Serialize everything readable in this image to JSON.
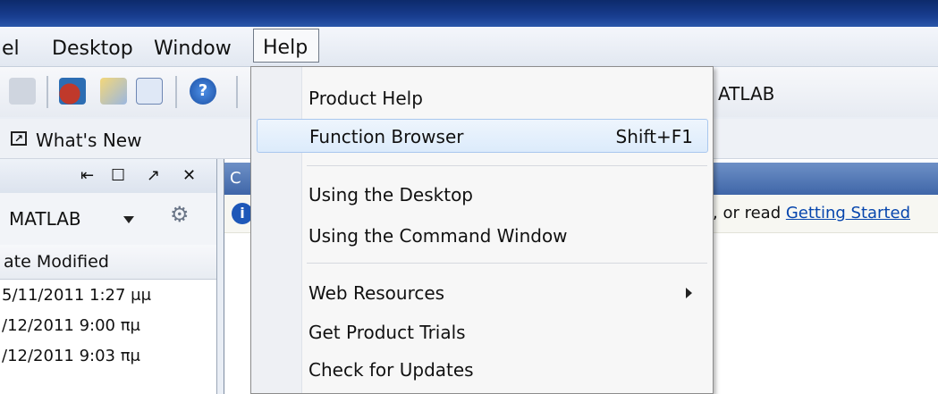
{
  "menubar": {
    "items": [
      "el",
      "Desktop",
      "Window",
      "Help"
    ]
  },
  "toolbar": {
    "current_folder_fragment": "ATLAB"
  },
  "shortcuts": {
    "whats_new": "What's New"
  },
  "left_panel": {
    "header_buttons": [
      "⇤",
      "☐",
      "↗",
      "✕"
    ],
    "folder_combo": "MATLAB",
    "column_header": "ate Modified",
    "rows": [
      "5/11/2011 1:27 μμ",
      "/12/2011 9:00 πμ",
      "/12/2011 9:03 πμ"
    ]
  },
  "command_window": {
    "title_fragment": "C",
    "info_text": ", or read ",
    "info_link": "Getting Started"
  },
  "help_menu": {
    "items": [
      {
        "label": "Product Help",
        "shortcut": ""
      },
      {
        "label": "Function Browser",
        "shortcut": "Shift+F1"
      },
      {
        "label": "Using the Desktop",
        "shortcut": ""
      },
      {
        "label": "Using the Command Window",
        "shortcut": ""
      },
      {
        "label": "Web Resources",
        "shortcut": ""
      },
      {
        "label": "Get Product Trials",
        "shortcut": ""
      },
      {
        "label": "Check for Updates",
        "shortcut": ""
      }
    ]
  },
  "colors": {
    "title_bar": "#183d8f",
    "highlight": "#dcebfb",
    "link": "#0645ad"
  }
}
